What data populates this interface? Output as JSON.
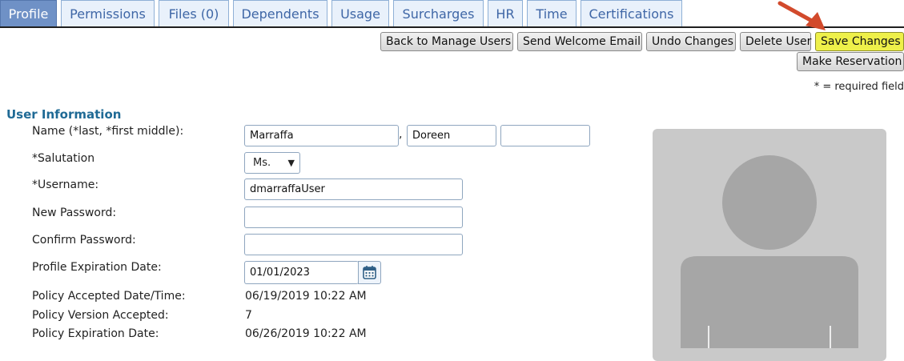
{
  "tabs": [
    {
      "label": "Profile",
      "active": true
    },
    {
      "label": "Permissions"
    },
    {
      "label": "Files (0)"
    },
    {
      "label": "Dependents"
    },
    {
      "label": "Usage"
    },
    {
      "label": "Surcharges"
    },
    {
      "label": "HR"
    },
    {
      "label": "Time"
    },
    {
      "label": "Certifications"
    }
  ],
  "toolbar": {
    "back_label": "Back to Manage Users",
    "welcome_label": "Send Welcome Email",
    "undo_label": "Undo Changes",
    "delete_label": "Delete User",
    "save_label": "Save Changes",
    "reservation_label": "Make Reservation"
  },
  "required_note": "* = required field",
  "section": {
    "title": "User Information"
  },
  "fields": {
    "name": {
      "label": "Name (*last, *first middle):",
      "last": "Marraffa",
      "separator": ",",
      "first": "Doreen",
      "middle": ""
    },
    "salutation": {
      "label": "*Salutation",
      "value": "Ms."
    },
    "username": {
      "label": "*Username:",
      "value": "dmarraffaUser"
    },
    "new_password": {
      "label": "New Password:",
      "value": ""
    },
    "confirm_password": {
      "label": "Confirm Password:",
      "value": ""
    },
    "expiration": {
      "label": "Profile Expiration Date:",
      "value": "01/01/2023"
    },
    "policy_accepted": {
      "label": "Policy Accepted Date/Time:",
      "value": "06/19/2019 10:22 AM"
    },
    "policy_version": {
      "label": "Policy Version Accepted:",
      "value": "7"
    },
    "policy_expiration": {
      "label": "Policy Expiration Date:",
      "value": "06/26/2019 10:22 AM"
    }
  },
  "colors": {
    "active_tab": "#6f91c6",
    "tab_text": "#3e66a6",
    "save_button": "#eef04a",
    "section_title": "#1f6a95",
    "annotation_arrow": "#d24a2c",
    "photo_placeholder": "#c9c9c9",
    "silhouette": "#a6a6a6"
  },
  "icons": {
    "calendar": "calendar-icon",
    "arrow": "annotation-arrow-icon",
    "avatar": "avatar-silhouette-icon"
  }
}
